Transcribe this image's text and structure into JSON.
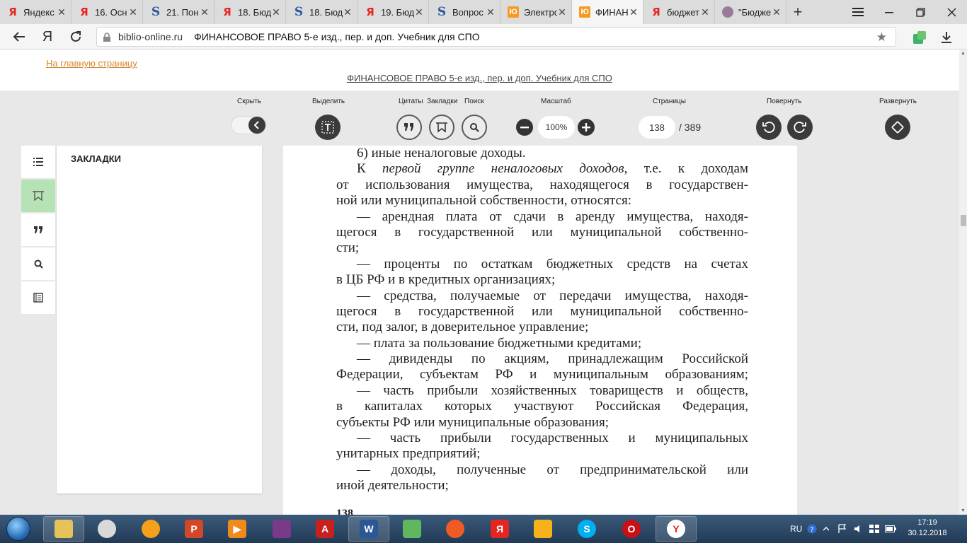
{
  "browser": {
    "tabs": [
      {
        "title": "Яндекс",
        "icon": "yandex-icon",
        "active": false
      },
      {
        "title": "16. Осн",
        "icon": "yandex-icon",
        "active": false
      },
      {
        "title": "21. Пон",
        "icon": "s-icon",
        "active": false
      },
      {
        "title": "18. Бюд",
        "icon": "yandex-icon",
        "active": false
      },
      {
        "title": "18. Бюд",
        "icon": "s-icon",
        "active": false
      },
      {
        "title": "19. Бюд",
        "icon": "yandex-icon",
        "active": false
      },
      {
        "title": "Вопрос",
        "icon": "s-icon",
        "active": false
      },
      {
        "title": "Электро",
        "icon": "yurait-icon",
        "active": false
      },
      {
        "title": "ФИНАН",
        "icon": "yurait-icon",
        "active": true
      },
      {
        "title": "бюджет",
        "icon": "yandex-icon",
        "active": false
      },
      {
        "title": "\"Бюдже",
        "icon": "image-icon",
        "active": false
      }
    ],
    "new_tab": "+",
    "address": {
      "domain": "biblio-online.ru",
      "page_title": "ФИНАНСОВОЕ ПРАВО 5-е изд., пер. и доп. Учебник для СПО"
    }
  },
  "site": {
    "home_link": "На главную страницу",
    "book_link": "ФИНАНСОВОЕ ПРАВО 5-е изд., пер. и доп. Учебник для СПО"
  },
  "toolbar": {
    "hide_label": "Скрыть",
    "select_label": "Выделить",
    "quotes_label": "Цитаты",
    "bookmarks_label": "Закладки",
    "search_label": "Поиск",
    "zoom_label": "Масштаб",
    "zoom_value": "100%",
    "pages_label": "Страницы",
    "page_current": "138",
    "page_total": "/ 389",
    "rotate_label": "Повернуть",
    "expand_label": "Развернуть"
  },
  "panel": {
    "title": "ЗАКЛАДКИ"
  },
  "page": {
    "lines": [
      {
        "text": "6) иные неналоговые доходы.",
        "indent": true,
        "last": true
      },
      {
        "html": "К <i>первой группе неналоговых доходов</i>, т.е. к доходам",
        "indent": true
      },
      {
        "text": "от использования имущества, находящегося в государствен-"
      },
      {
        "text": "ной или муниципальной собственности, относятся:",
        "last": true
      },
      {
        "text": "— арендная плата от сдачи в аренду имущества, находя-",
        "indent": true
      },
      {
        "text": "щегося в государственной или муниципальной собственно-"
      },
      {
        "text": "сти;",
        "last": true
      },
      {
        "text": "— проценты по остаткам бюджетных средств на счетах",
        "indent": true
      },
      {
        "text": "в ЦБ РФ и в кредитных организациях;",
        "last": true
      },
      {
        "text": "— средства, получаемые от передачи имущества, находя-",
        "indent": true
      },
      {
        "text": "щегося в государственной или муниципальной собственно-"
      },
      {
        "text": "сти, под залог, в доверительное управление;",
        "last": true
      },
      {
        "text": "— плата за пользование бюджетными кредитами;",
        "indent": true,
        "last": true
      },
      {
        "text": "— дивиденды по акциям, принадлежащим Российской",
        "indent": true
      },
      {
        "text": "Федерации, субъектам РФ и муниципальным образованиям;"
      },
      {
        "text": "— часть прибыли хозяйственных товариществ и обществ,",
        "indent": true
      },
      {
        "text": "в капиталах которых участвуют Российская Федерация,"
      },
      {
        "text": "субъекты РФ или муниципальные образования;",
        "last": true
      },
      {
        "text": "— часть прибыли государственных и муниципальных",
        "indent": true
      },
      {
        "text": "унитарных предприятий;",
        "last": true
      },
      {
        "text": "— доходы, полученные от предпринимательской или",
        "indent": true
      },
      {
        "text": "иной деятельности;",
        "last": true
      }
    ],
    "page_number": "138"
  },
  "taskbar": {
    "language": "RU",
    "time": "17:19",
    "date": "30.12.2018"
  },
  "colors": {
    "link_orange": "#d2872c",
    "active_rail": "#b6e3b6",
    "toolbar_bg": "#e8e8e8"
  }
}
